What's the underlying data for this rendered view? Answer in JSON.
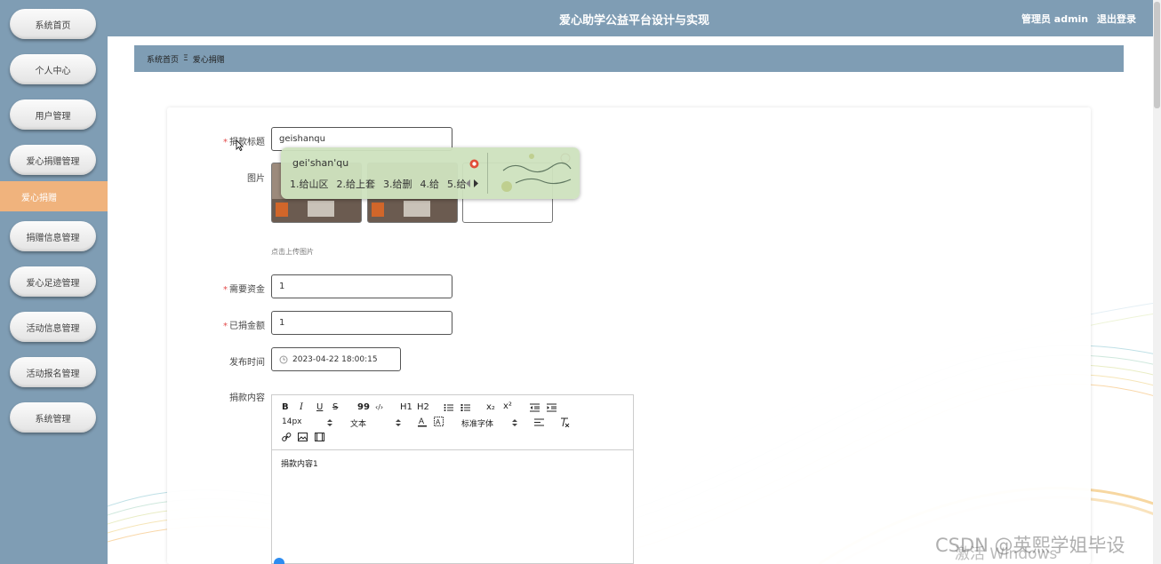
{
  "app": {
    "title": "爱心助学公益平台设计与实现"
  },
  "header": {
    "user_label": "管理员 admin",
    "logout": "退出登录"
  },
  "sidebar": {
    "items": [
      {
        "label": "系统首页"
      },
      {
        "label": "个人中心"
      },
      {
        "label": "用户管理"
      },
      {
        "label": "爱心捐赠管理"
      },
      {
        "label": "爱心捐赠"
      },
      {
        "label": "捐赠信息管理"
      },
      {
        "label": "爱心足迹管理"
      },
      {
        "label": "活动信息管理"
      },
      {
        "label": "活动报名管理"
      },
      {
        "label": "系统管理"
      }
    ]
  },
  "breadcrumb": {
    "home": "系统首页",
    "separator": "Ξ",
    "current": "爱心捐赠"
  },
  "form": {
    "title_label": "捐款标题",
    "title_value": "geishanqu",
    "image_label": "图片",
    "upload_hint": "点击上传图片",
    "fund_label": "需要资金",
    "fund_value": "1",
    "donated_label": "已捐金额",
    "donated_value": "1",
    "time_label": "发布时间",
    "time_value": "2023-04-22 18:00:15",
    "content_label": "捐款内容",
    "content_value": "捐款内容1"
  },
  "ime": {
    "pinyin": "gei'shan'qu",
    "candidates": [
      "1.给山区",
      "2.给上套",
      "3.给删",
      "4.给",
      "5.给"
    ]
  },
  "editor": {
    "bold": "B",
    "italic": "I",
    "underline": "U",
    "strike": "S",
    "quote": "99",
    "code": "‹/›",
    "h1": "H1",
    "h2": "H2",
    "sub": "x₂",
    "sup": "x²",
    "font_size": "14px",
    "text_type": "文本",
    "font_family": "标准字体"
  },
  "watermark": {
    "csdn": "CSDN @英熙学姐毕设",
    "windows": "激活 Windows"
  },
  "colors": {
    "sidebar": "#7f9db4",
    "active": "#f0b37d",
    "required": "#e34b4b"
  }
}
